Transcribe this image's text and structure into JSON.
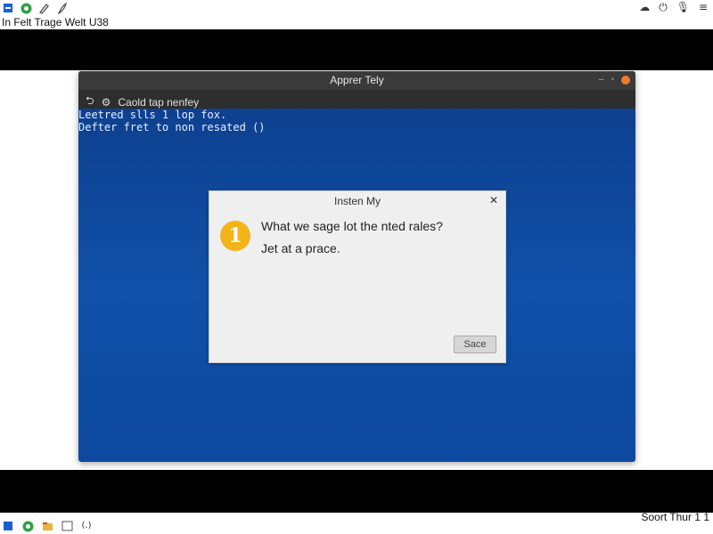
{
  "host": {
    "menu_text": "In Felt Trage Welt U38",
    "top_icons": [
      "app-icon-blue",
      "chrome-icon",
      "pen-icon",
      "feather-icon"
    ],
    "tray_icons": [
      "cloud-icon",
      "power-icon",
      "mic-icon",
      "bars-icon"
    ],
    "taskbar_icons": [
      "app-icon-blue",
      "chrome-icon",
      "folder-icon",
      "window-icon",
      "terminal-icon"
    ],
    "clock": "Soort Thur 1 1"
  },
  "window": {
    "title": "Apprer Tely",
    "toolbar_label": "Caold tap nenfey",
    "colors": {
      "background": "#1050a8",
      "titlebar": "#3a3a3a",
      "close": "#f07b2b"
    }
  },
  "terminal": {
    "lines": [
      "Leetred slls 1 lop fox.",
      "Defter fret to non resated ()"
    ]
  },
  "dialog": {
    "title": "Insten My",
    "badge": "1",
    "message_line1": "What we sage lot the nted rales?",
    "message_line2": "Jet at a prace.",
    "button_label": "Sace",
    "badge_color": "#f2b418"
  }
}
